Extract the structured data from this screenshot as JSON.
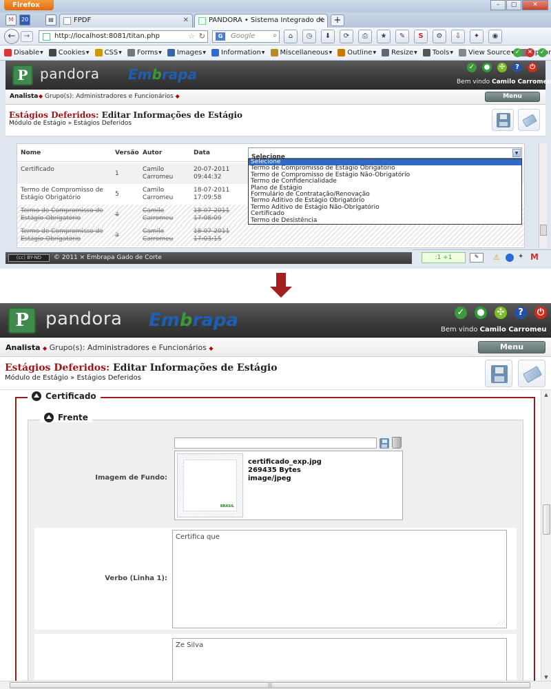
{
  "browser": {
    "app_button": "Firefox",
    "tabs": [
      {
        "label": "FPDF"
      },
      {
        "label": "PANDORA • Sistema Integrado de Ge..."
      }
    ],
    "tab_counter": "20",
    "url": "http://localhost:8081/titan.php",
    "search_placeholder": "Google",
    "search_engine_glyph": "G",
    "webdev_toolbar": [
      {
        "label": "Disable",
        "color": "#d33"
      },
      {
        "label": "Cookies",
        "color": "#444"
      },
      {
        "label": "CSS",
        "color": "#c90"
      },
      {
        "label": "Forms",
        "color": "#777"
      },
      {
        "label": "Images",
        "color": "#36a"
      },
      {
        "label": "Information",
        "color": "#2a6dd6"
      },
      {
        "label": "Miscellaneous",
        "color": "#b82"
      },
      {
        "label": "Outline",
        "color": "#c70"
      },
      {
        "label": "Resize",
        "color": "#667"
      },
      {
        "label": "Tools",
        "color": "#555"
      },
      {
        "label": "View Source",
        "color": "#888"
      },
      {
        "label": "Options",
        "color": "#777"
      }
    ]
  },
  "app": {
    "logo_letter": "P",
    "logo_text": "pandora",
    "partner_logo": {
      "part1": "Em",
      "part2": "b",
      "part3": "rapa"
    },
    "header_icons": [
      {
        "name": "shield-icon",
        "color": "#3c9a3c",
        "glyph": "✓"
      },
      {
        "name": "brazil-flag-icon",
        "color": "#2e9d3a",
        "glyph": "●"
      },
      {
        "name": "puzzle-icon",
        "color": "#7bbd2a",
        "glyph": "✣"
      },
      {
        "name": "help-icon",
        "color": "#2451a8",
        "glyph": "?"
      },
      {
        "name": "power-icon",
        "color": "#d42a1c",
        "glyph": "⏻"
      }
    ],
    "welcome_prefix": "Bem vindo",
    "user_name": "Camilo Carromeu",
    "role": "Analista",
    "groups_label": "Grupo(s):",
    "groups_value": "Administradores e Funcionários",
    "menu_label": "Menu",
    "title_red": "Estágios Deferidos:",
    "title_rest": "Editar Informações de Estágio",
    "breadcrumb": "Módulo de Estágio » Estágios Deferidos",
    "footer": "© 2011 × Embrapa Gado de Corte",
    "cc_badge": "(cc) BY-ND"
  },
  "grid": {
    "columns": [
      "Nome",
      "Versão",
      "Autor",
      "Data"
    ],
    "select_value": "Selecione",
    "rows": [
      {
        "nome": "Certificado",
        "versao": "1",
        "autor": "Camilo Carromeu",
        "data": "20-07-2011 09:44:32",
        "struck": false
      },
      {
        "nome": "Termo de Compromisso de Estágio Obrigatório",
        "versao": "5",
        "autor": "Camilo Carromeu",
        "data": "18-07-2011 17:09:58",
        "struck": false
      },
      {
        "nome": "Termo de Compromisso de Estágio Obrigatório",
        "versao": "4",
        "autor": "Camilo Carromeu",
        "data": "18-07-2011 17:08:09",
        "struck": true
      },
      {
        "nome": "Termo de Compromisso de Estágio Obrigatório",
        "versao": "3",
        "autor": "Camilo Carromeu",
        "data": "18-07-2011 17:03:15",
        "struck": true
      }
    ],
    "dropdown_options": [
      "Selecione",
      "Termo de Compromisso de Estágio Obrigatório",
      "Termo de Compromisso de Estágio Não-Obrigatório",
      "Termo de Confidencialidade",
      "Plano de Estágio",
      "Formulário de Contratação/Renovação",
      "Termo Aditivo de Estágio Obrigatório",
      "Termo Aditivo de Estágio Não-Obrigatório",
      "Certificado",
      "Termo de Desistência"
    ]
  },
  "status": {
    "pill": ":1 +1"
  },
  "form": {
    "section": "Certificado",
    "subsection": "Frente",
    "image_label": "Imagem de Fundo:",
    "file_name": "certificado_exp.jpg",
    "file_size": "269435 Bytes",
    "file_type": "image/jpeg",
    "thumb_mark": "BRASIL",
    "verbo_label": "Verbo (Linha 1):",
    "verbo_value": "Certifica que",
    "next_value": "Ze Silva"
  }
}
